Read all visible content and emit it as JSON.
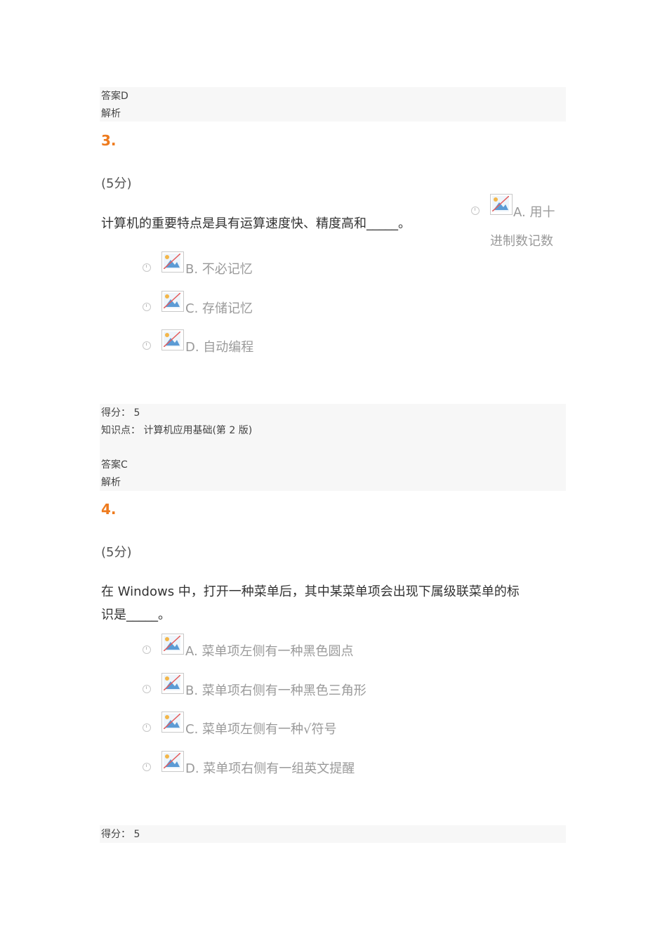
{
  "q2_footer": {
    "answer": "答案D",
    "analysis": "解析"
  },
  "q3": {
    "number": "3.",
    "points": "(5分)",
    "question": "计算机的重要特点是具有运算速度快、精度高和_____。",
    "options": [
      {
        "line1": "A. 用十",
        "line2": "进制数记数"
      },
      {
        "label": "B. 不必记忆"
      },
      {
        "label": "C. 存储记忆"
      },
      {
        "label": "D. 自动编程"
      }
    ],
    "footer": {
      "score": "得分：  5",
      "knowledge": "知识点：  计算机应用基础(第 2 版)",
      "answer": "答案C",
      "analysis": "解析"
    }
  },
  "q4": {
    "number": "4.",
    "points": "(5分)",
    "question_line1": "在 Windows 中，打开一种菜单后，其中某菜单项会出现下属级联菜单的标",
    "question_line2": "识是_____。",
    "options": [
      {
        "label": "A. 菜单项左侧有一种黑色圆点"
      },
      {
        "label": "B. 菜单项右侧有一种黑色三角形"
      },
      {
        "label": "C. 菜单项左侧有一种√符号"
      },
      {
        "label": "D. 菜单项右侧有一组英文提醒"
      }
    ],
    "footer": {
      "score": "得分：  5"
    }
  },
  "icons": {
    "radio": "radio-button-icon",
    "image": "broken-image-icon"
  }
}
